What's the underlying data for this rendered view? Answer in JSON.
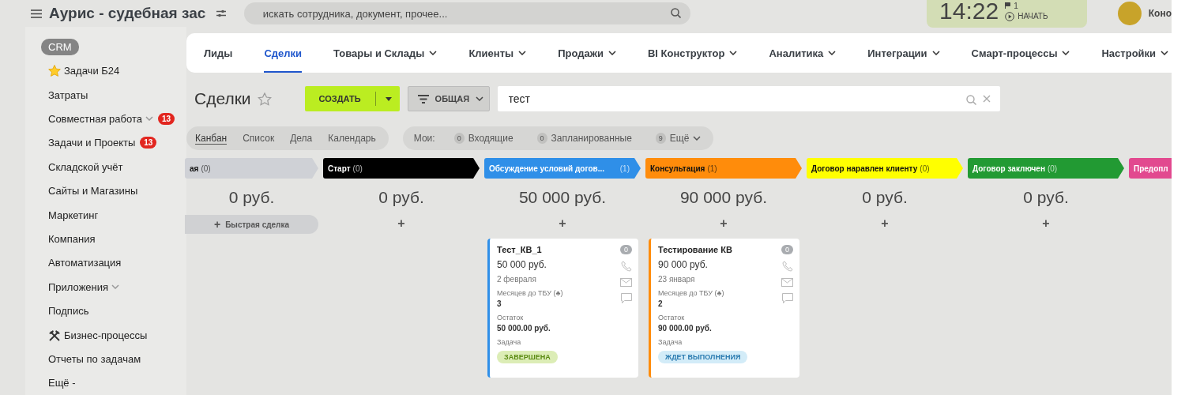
{
  "header": {
    "title": "Аурис - судебная зас",
    "search": {
      "placeholder": "искать сотрудника, документ, прочее..."
    },
    "clock": {
      "time": "14:22",
      "flag_count": "1",
      "start_label": "НАЧАТЬ"
    },
    "user": {
      "name": "Коно"
    }
  },
  "sidebar": {
    "items": [
      {
        "label": "CRM",
        "selected": true
      },
      {
        "label": "Задачи Б24",
        "selected": false,
        "kind": "star"
      },
      {
        "label": "Затраты",
        "selected": false
      },
      {
        "label": "Совместная работа",
        "selected": false,
        "has_menu": true,
        "badge": "13"
      },
      {
        "label": "Задачи и Проекты",
        "selected": false,
        "badge": "13"
      },
      {
        "label": "Складской учёт",
        "selected": false
      },
      {
        "label": "Сайты и Магазины",
        "selected": false
      },
      {
        "label": "Маркетинг",
        "selected": false
      },
      {
        "label": "Компания",
        "selected": false
      },
      {
        "label": "Автоматизация",
        "selected": false
      },
      {
        "label": "Приложения",
        "selected": false,
        "has_menu": true
      },
      {
        "label": "Подпись",
        "selected": false
      },
      {
        "label": "Бизнес-процессы",
        "selected": false,
        "kind": "hammers"
      },
      {
        "label": "Отчеты по задачам",
        "selected": false
      },
      {
        "label": "Ещё -",
        "selected": false
      }
    ]
  },
  "nav_tabs": [
    {
      "label": "Лиды",
      "selected": false,
      "has_menu": false
    },
    {
      "label": "Сделки",
      "selected": true,
      "has_menu": false
    },
    {
      "label": "Товары и Склады",
      "selected": false,
      "has_menu": true
    },
    {
      "label": "Клиенты",
      "selected": false,
      "has_menu": true
    },
    {
      "label": "Продажи",
      "selected": false,
      "has_menu": true
    },
    {
      "label": "BI Конструктор",
      "selected": false,
      "has_menu": true
    },
    {
      "label": "Аналитика",
      "selected": false,
      "has_menu": true
    },
    {
      "label": "Интеграции",
      "selected": false,
      "has_menu": true
    },
    {
      "label": "Смарт-процессы",
      "selected": false,
      "has_menu": true
    },
    {
      "label": "Настройки",
      "selected": false,
      "has_menu": true
    }
  ],
  "page": {
    "title": "Сделки",
    "create_label": "СОЗДАТЬ",
    "filter_label": "ОБЩАЯ",
    "search_value": "тест"
  },
  "view_tabs": [
    {
      "label": "Канбан",
      "selected": true
    },
    {
      "label": "Список",
      "selected": false
    },
    {
      "label": "Дела",
      "selected": false
    },
    {
      "label": "Календарь",
      "selected": false
    }
  ],
  "counters": {
    "label": "Мои:",
    "items": [
      {
        "count": "0",
        "label": "Входящие"
      },
      {
        "count": "0",
        "label": "Запланированные"
      },
      {
        "count": "9",
        "label": "Ещё",
        "has_menu": true
      }
    ]
  },
  "kanban": {
    "columns": [
      {
        "name": "ая",
        "count": "(0)",
        "color": "#cfd1d6",
        "total": "0 руб.",
        "add": "+",
        "quick_add": "Быстрая сделка"
      },
      {
        "name": "Старт",
        "count": "(0)",
        "color": "#000000",
        "total": "0 руб.",
        "add": "+"
      },
      {
        "name": "Обсуждение условий догов...",
        "count": "(1)",
        "color": "#2f8fe8",
        "total": "50 000 руб.",
        "add": "+",
        "cards": [
          {
            "title": "Тест_КВ_1",
            "badge": "0",
            "amount": "50 000 руб.",
            "date": "2 февраля",
            "fields": [
              {
                "label": "Месяцев до ТБУ (♣)",
                "value": "3"
              },
              {
                "label": "Остаток",
                "value": "50 000.00 руб."
              },
              {
                "label": "Задача"
              }
            ],
            "task": {
              "kind": "done",
              "label": "ЗАВЕРШЕНА"
            }
          }
        ]
      },
      {
        "name": "Консультация",
        "count": "(1)",
        "color": "#ff8c0b",
        "total": "90 000 руб.",
        "add": "+",
        "cards": [
          {
            "title": "Тестирование КВ",
            "badge": "0",
            "amount": "90 000 руб.",
            "date": "23 января",
            "fields": [
              {
                "label": "Месяцев до ТБУ (♣)",
                "value": "2"
              },
              {
                "label": "Остаток",
                "value": "90 000.00 руб."
              },
              {
                "label": "Задача"
              }
            ],
            "task": {
              "kind": "waiting",
              "label": "ЖДЕТ ВЫПОЛНЕНИЯ"
            }
          }
        ]
      },
      {
        "name": "Договор наравлен клиенту",
        "count": "(0)",
        "color": "#ffff00",
        "total": "0 руб.",
        "add": "+"
      },
      {
        "name": "Договор заключен",
        "count": "(0)",
        "color": "#229a33",
        "total": "0 руб.",
        "add": "+"
      },
      {
        "name": "Предопл",
        "color": "#e2498f"
      }
    ]
  }
}
